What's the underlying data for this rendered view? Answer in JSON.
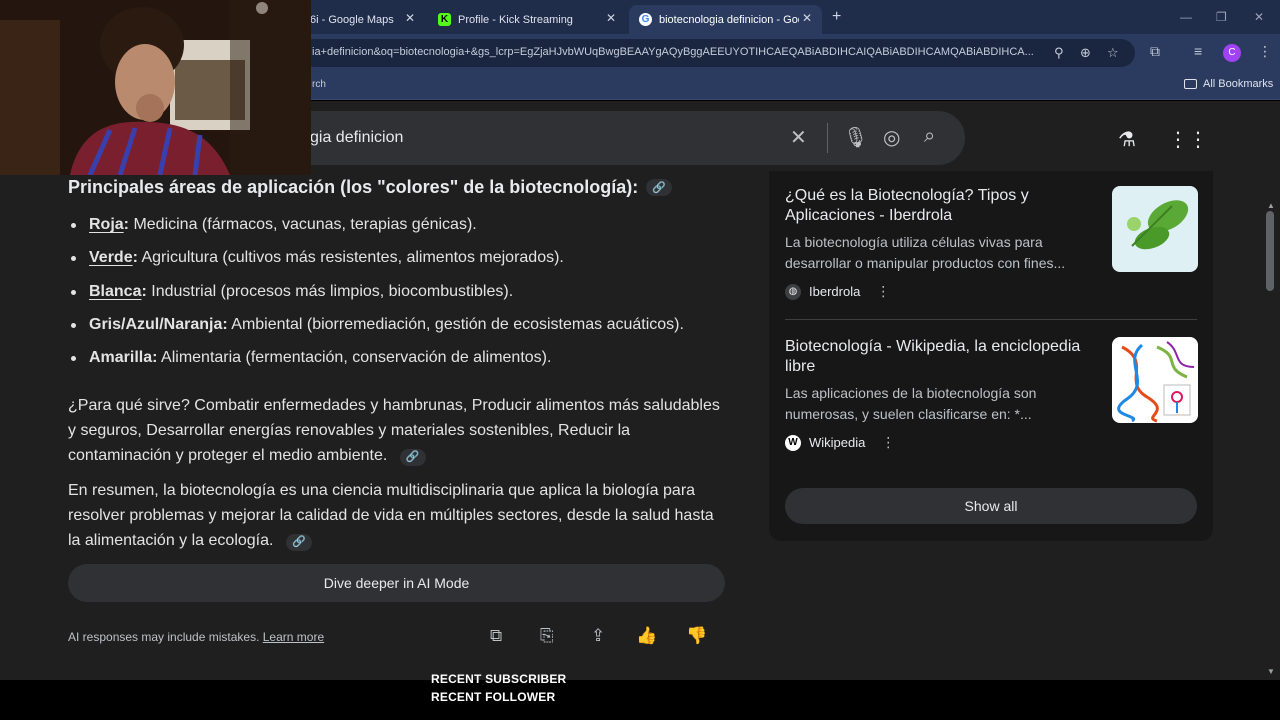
{
  "browser": {
    "tabs": [
      {
        "title": "6i - Google Maps",
        "active": false
      },
      {
        "title": "Profile - Kick Streaming",
        "active": false
      },
      {
        "title": "biotecnologia definicion - Goo",
        "active": true
      }
    ],
    "url": "ia+definicion&oq=biotecnologia+&gs_lcrp=EgZjaHJvbWUqBwgBEAAYgAQyBggAEEUYOTIHCAEQABiABDIHCAIQABiABDIHCAMQABiABDIHCA...",
    "bookmark_partial": "rch",
    "bookmarks_label": "All Bookmarks",
    "profile_initial": "C"
  },
  "search": {
    "query": "gia definicion"
  },
  "profile_initial": "C",
  "content": {
    "heading": "Principales áreas de aplicación (los \"colores\" de la biotecnología):",
    "areas": [
      {
        "key": "Roja",
        "sep": ":",
        "text": " Medicina (fármacos, vacunas, terapias génicas)."
      },
      {
        "key": "Verde",
        "sep": ":",
        "text": " Agricultura (cultivos más resistentes, alimentos mejorados)."
      },
      {
        "key": "Blanca",
        "sep": ":",
        "text": " Industrial (procesos más limpios, biocombustibles)."
      },
      {
        "key": "Gris/Azul/Naranja",
        "sep": ":",
        "text": " Ambiental (biorremediación, gestión de ecosistemas acuáticos)."
      },
      {
        "key": "Amarilla",
        "sep": ":",
        "text": " Alimentaria (fermentación, conservación de alimentos)."
      }
    ],
    "para1": "¿Para qué sirve? Combatir enfermedades y hambrunas, Producir alimentos más saludables y seguros, Desarrollar energías renovables y materiales sostenibles, Reducir la contaminación y proteger el medio ambiente.",
    "para2": "En resumen, la biotecnología es una ciencia multidisciplinaria que aplica la biología para resolver problemas y mejorar la calidad de vida en múltiples sectores, desde la salud hasta la alimentación y la ecología.",
    "dive_button": "Dive deeper in AI Mode",
    "disclaimer": "AI responses may include mistakes. ",
    "learn_more": "Learn more"
  },
  "sources": [
    {
      "title": "¿Qué es la Biotecnología? Tipos y Aplicaciones - Iberdrola",
      "snippet": "La biotecnología utiliza células vivas para desarrollar o manipular productos con fines...",
      "site": "Iberdrola"
    },
    {
      "title": "Biotecnología - Wikipedia, la enciclopedia libre",
      "snippet": "Las aplicaciones de la biotecnología son numerosas, y suelen clasificarse en: *...",
      "site": "Wikipedia"
    }
  ],
  "show_all": "Show all",
  "stream_overlay": {
    "line1": "RECENT SUBSCRIBER",
    "line2": "RECENT FOLLOWER"
  },
  "colors": {
    "page_bg": "#1f1f1f",
    "chrome_bg": "#2b3b5f",
    "tabbar_bg": "#1f2c4a",
    "accent_avatar": "#a142f4"
  }
}
